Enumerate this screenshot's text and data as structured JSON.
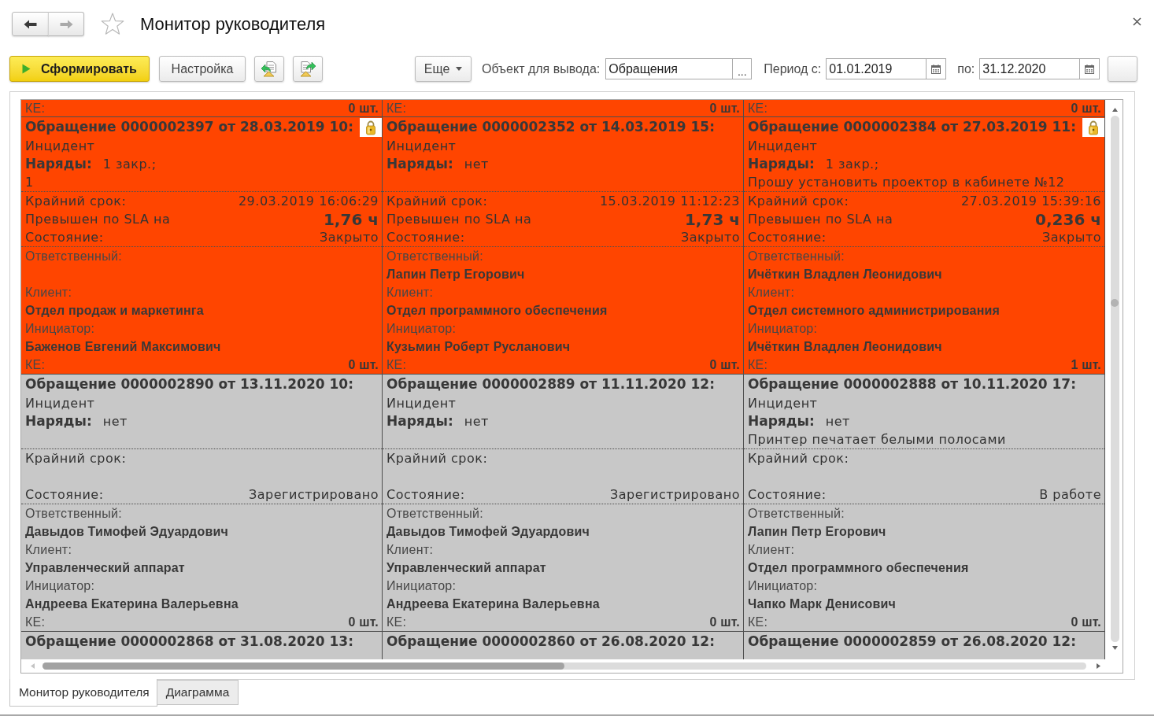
{
  "window": {
    "title": "Монитор руководителя"
  },
  "nav": [
    {
      "kind": "back",
      "disabled": false
    },
    {
      "kind": "forward",
      "disabled": true
    }
  ],
  "favorite": false,
  "toolbar": {
    "generate_button": "Сформировать",
    "settings_button": "Настройка",
    "more_button": "Еще",
    "output_object": {
      "label": "Объект для вывода:",
      "value": "Обращения",
      "select_button": "..."
    },
    "period_from": {
      "label": "Период с:",
      "value": "01.01.2019"
    },
    "period_to": {
      "label": "по:",
      "value": "31.12.2020"
    }
  },
  "report": {
    "rows": [
      {
        "cards": [
          {
            "color": "#ff4500",
            "ke": {
              "label": "КЕ:",
              "value": "0 шт."
            }
          },
          {
            "color": "#ff4500",
            "ke": {
              "label": "КЕ:",
              "value": "0 шт."
            }
          },
          {
            "color": "#ff4500",
            "ke": {
              "label": "КЕ:",
              "value": "0 шт."
            }
          }
        ]
      },
      {
        "cards": [
          {
            "color": "#ff4500",
            "title": "Обращение 0000002397 от 28.03.2019 10:",
            "locked": true,
            "type": "Инцидент",
            "orders": {
              "label": "Наряды:",
              "value": "1 закр.;"
            },
            "description": "1",
            "deadline": {
              "label": "Крайний срок:",
              "value": "29.03.2019 16:06:29"
            },
            "sla": {
              "label": "Превышен по SLA на",
              "value": "1,76 ч"
            },
            "state": {
              "label": "Состояние:",
              "value": "Закрыто"
            },
            "responsible": {
              "label": "Ответственный:"
            },
            "client": {
              "label": "Клиент:",
              "value": "Отдел продаж и маркетинга"
            },
            "initiator": {
              "label": "Инициатор:",
              "value": "Баженов Евгений Максимович"
            },
            "ke": {
              "label": "КЕ:",
              "value": "0 шт."
            }
          },
          {
            "color": "#ff4500",
            "title": "Обращение 0000002352 от 14.03.2019 15:",
            "locked": false,
            "type": "Инцидент",
            "orders": {
              "label": "Наряды:",
              "value": "нет"
            },
            "deadline": {
              "label": "Крайний срок:",
              "value": "15.03.2019 11:12:23"
            },
            "sla": {
              "label": "Превышен по SLA на",
              "value": "1,73 ч"
            },
            "state": {
              "label": "Состояние:",
              "value": "Закрыто"
            },
            "responsible": {
              "label": "Ответственный:",
              "value": "Лапин Петр Егорович"
            },
            "client": {
              "label": "Клиент:",
              "value": "Отдел программного обеспечения"
            },
            "initiator": {
              "label": "Инициатор:",
              "value": "Кузьмин Роберт Русланович"
            },
            "ke": {
              "label": "КЕ:",
              "value": "0 шт."
            }
          },
          {
            "color": "#ff4500",
            "title": "Обращение 0000002384 от 27.03.2019 11:",
            "locked": true,
            "type": "Инцидент",
            "orders": {
              "label": "Наряды:",
              "value": "1 закр.;"
            },
            "description": "Прошу установить проектор в кабинете №12",
            "deadline": {
              "label": "Крайний срок:",
              "value": "27.03.2019 15:39:16"
            },
            "sla": {
              "label": "Превышен по SLA на",
              "value": "0,236 ч"
            },
            "state": {
              "label": "Состояние:",
              "value": "Закрыто"
            },
            "responsible": {
              "label": "Ответственный:",
              "value": "Ичёткин Владлен Леонидович"
            },
            "client": {
              "label": "Клиент:",
              "value": "Отдел системного администрирования"
            },
            "initiator": {
              "label": "Инициатор:",
              "value": "Ичёткин Владлен Леонидович"
            },
            "ke": {
              "label": "КЕ:",
              "value": "1 шт."
            }
          }
        ]
      },
      {
        "cards": [
          {
            "color": "#c8c8c8",
            "title": "Обращение 0000002890 от 13.11.2020 10:",
            "locked": false,
            "type": "Инцидент",
            "orders": {
              "label": "Наряды:",
              "value": "нет"
            },
            "deadline": {
              "label": "Крайний срок:"
            },
            "state": {
              "label": "Состояние:",
              "value": "Зарегистрировано"
            },
            "responsible": {
              "label": "Ответственный:",
              "value": "Давыдов Тимофей Эдуардович"
            },
            "client": {
              "label": "Клиент:",
              "value": "Управленческий аппарат"
            },
            "initiator": {
              "label": "Инициатор:",
              "value": "Андреева Екатерина Валерьевна"
            },
            "ke": {
              "label": "КЕ:",
              "value": "0 шт."
            }
          },
          {
            "color": "#c8c8c8",
            "title": "Обращение 0000002889 от 11.11.2020 12:",
            "locked": false,
            "type": "Инцидент",
            "orders": {
              "label": "Наряды:",
              "value": "нет"
            },
            "deadline": {
              "label": "Крайний срок:"
            },
            "state": {
              "label": "Состояние:",
              "value": "Зарегистрировано"
            },
            "responsible": {
              "label": "Ответственный:",
              "value": "Давыдов Тимофей Эдуардович"
            },
            "client": {
              "label": "Клиент:",
              "value": "Управленческий аппарат"
            },
            "initiator": {
              "label": "Инициатор:",
              "value": "Андреева Екатерина Валерьевна"
            },
            "ke": {
              "label": "КЕ:",
              "value": "0 шт."
            }
          },
          {
            "color": "#c8c8c8",
            "title": "Обращение 0000002888 от 10.11.2020 17:",
            "locked": false,
            "type": "Инцидент",
            "orders": {
              "label": "Наряды:",
              "value": "нет"
            },
            "description": "Принтер печатает белыми полосами",
            "deadline": {
              "label": "Крайний срок:"
            },
            "state": {
              "label": "Состояние:",
              "value": "В работе"
            },
            "responsible": {
              "label": "Ответственный:",
              "value": "Лапин Петр Егорович"
            },
            "client": {
              "label": "Клиент:",
              "value": "Отдел программного обеспечения"
            },
            "initiator": {
              "label": "Инициатор:",
              "value": "Чапко Марк Денисович"
            },
            "ke": {
              "label": "КЕ:",
              "value": "0 шт."
            }
          }
        ]
      },
      {
        "cards": [
          {
            "color": "#c8c8c8",
            "title": "Обращение 0000002868 от 31.08.2020 13:",
            "locked": false
          },
          {
            "color": "#c8c8c8",
            "title": "Обращение 0000002860 от 26.08.2020 12:",
            "locked": false
          },
          {
            "color": "#c8c8c8",
            "title": "Обращение 0000002859 от 26.08.2020 12:",
            "locked": false
          }
        ]
      }
    ]
  },
  "tabs": [
    {
      "label": "Монитор руководителя",
      "selected": true
    },
    {
      "label": "Диаграмма",
      "selected": false
    }
  ]
}
